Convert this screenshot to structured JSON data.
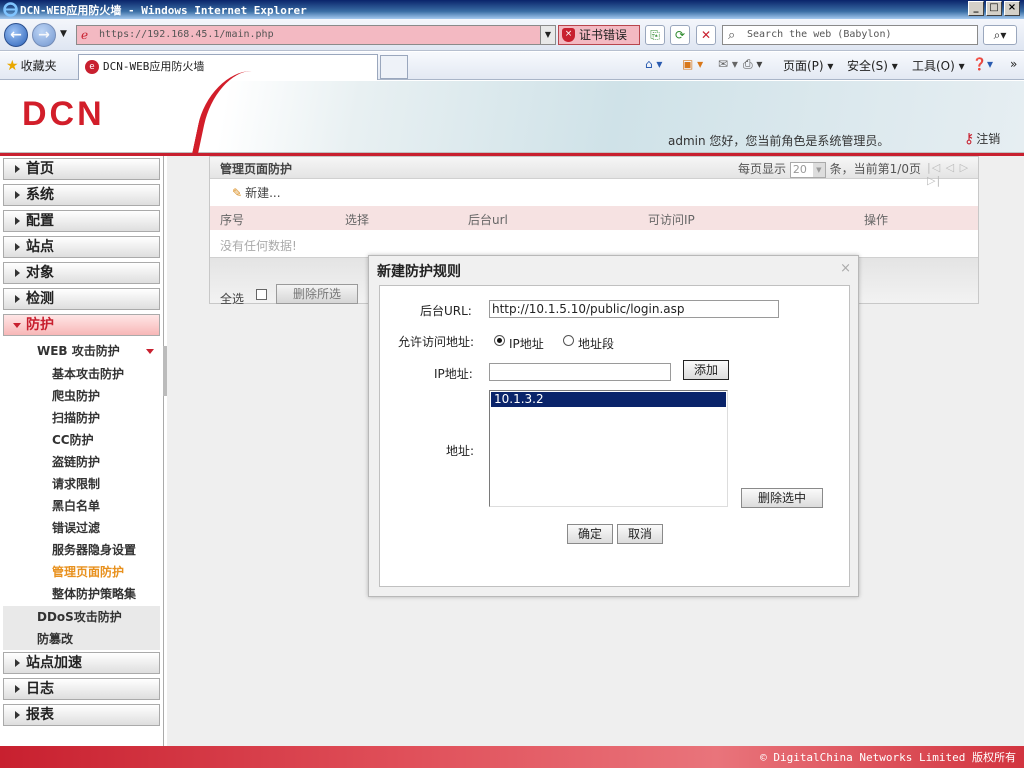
{
  "window": {
    "title": "DCN-WEB应用防火墙 - Windows Internet Explorer"
  },
  "browser": {
    "url": "https://192.168.45.1/main.php",
    "cert_error": "证书错误",
    "search_placeholder": "Search the web (Babylon)",
    "favorites_label": "收藏夹",
    "tab_title": "DCN-WEB应用防火墙",
    "menu": {
      "page": "页面(P)",
      "security": "安全(S)",
      "tools": "工具(O)"
    }
  },
  "header": {
    "logo": "DCN",
    "welcome": "admin 您好，您当前角色是系统管理员。",
    "logout": "注销"
  },
  "sidebar": {
    "top_items": [
      "首页",
      "系统",
      "配置",
      "站点",
      "对象",
      "检测"
    ],
    "active_item": "防护",
    "web_group": "WEB 攻击防护",
    "web_children": [
      "基本攻击防护",
      "爬虫防护",
      "扫描防护",
      "CC防护",
      "盗链防护",
      "请求限制",
      "黑白名单",
      "错误过滤",
      "服务器隐身设置",
      "管理页面防护",
      "整体防护策略集"
    ],
    "selected_child": "管理页面防护",
    "sub_groups": [
      "DDoS攻击防护",
      "防篡改"
    ],
    "bottom_items": [
      "站点加速",
      "日志",
      "报表"
    ]
  },
  "panel": {
    "title": "管理页面防护",
    "pager_prefix": "每页显示",
    "page_size": "20",
    "pager_suffix": "条，当前第1/0页",
    "new_label": "新建...",
    "columns": [
      "序号",
      "选择",
      "后台url",
      "可访问IP",
      "操作"
    ],
    "empty_text": "没有任何数据!",
    "select_all": "全选",
    "delete_selected": "删除所选"
  },
  "dialog": {
    "title": "新建防护规则",
    "close": "×",
    "url_label": "后台URL:",
    "url_value": "http://10.1.5.10/public/login.asp",
    "access_label": "允许访问地址:",
    "radio_ip": "IP地址",
    "radio_range": "地址段",
    "ip_label": "IP地址:",
    "ip_value": "",
    "add_button": "添加",
    "address_label": "地址:",
    "addresses": [
      "10.1.3.2"
    ],
    "delete_selected_button": "删除选中",
    "ok_button": "确定",
    "cancel_button": "取消"
  },
  "footer": {
    "copyright": "© DigitalChina Networks Limited 版权所有"
  }
}
